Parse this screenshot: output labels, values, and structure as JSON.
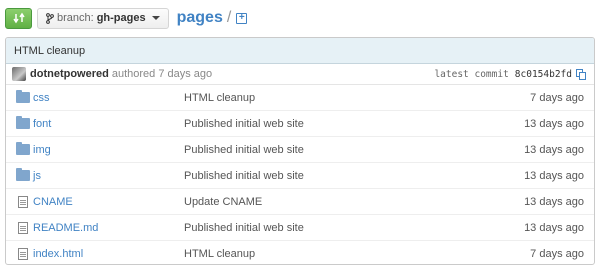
{
  "toolbar": {
    "compare_icon": "compare-arrows-icon",
    "branch_label": "branch:",
    "branch_name": "gh-pages",
    "repo_name": "pages",
    "separator": "/",
    "new_file_glyph": "+"
  },
  "commit": {
    "title": "HTML cleanup",
    "author": "dotnetpowered",
    "authored_text": "authored 7 days ago",
    "latest_label": "latest commit",
    "sha": "8c0154b2fd"
  },
  "files": [
    {
      "name": "css",
      "type": "folder",
      "message": "HTML cleanup",
      "age": "7 days ago"
    },
    {
      "name": "font",
      "type": "folder",
      "message": "Published initial web site",
      "age": "13 days ago"
    },
    {
      "name": "img",
      "type": "folder",
      "message": "Published initial web site",
      "age": "13 days ago"
    },
    {
      "name": "js",
      "type": "folder",
      "message": "Published initial web site",
      "age": "13 days ago"
    },
    {
      "name": "CNAME",
      "type": "file",
      "message": "Update CNAME",
      "age": "13 days ago"
    },
    {
      "name": "README.md",
      "type": "file",
      "message": "Published initial web site",
      "age": "13 days ago"
    },
    {
      "name": "index.html",
      "type": "file",
      "message": "HTML cleanup",
      "age": "7 days ago"
    }
  ],
  "colors": {
    "link": "#4183c4",
    "compare_green": "#60b044",
    "commit_bar": "#e6f1f6"
  }
}
